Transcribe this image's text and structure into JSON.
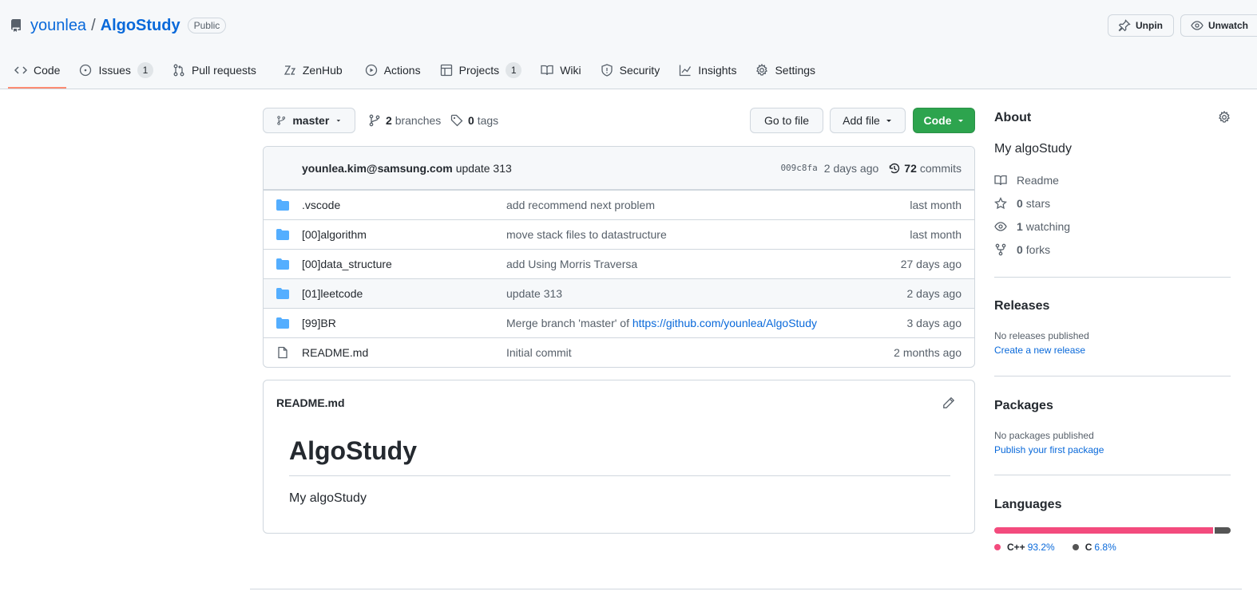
{
  "repo": {
    "owner": "younlea",
    "separator": "/",
    "name": "AlgoStudy",
    "visibility": "Public"
  },
  "header_actions": {
    "unpin": "Unpin",
    "unwatch": "Unwatch"
  },
  "tabs": [
    {
      "label": "Code",
      "icon": "code-icon",
      "counter": ""
    },
    {
      "label": "Issues",
      "icon": "issue-icon",
      "counter": "1"
    },
    {
      "label": "Pull requests",
      "icon": "pull-request-icon",
      "counter": ""
    },
    {
      "label": "ZenHub",
      "icon": "zenhub-icon",
      "counter": ""
    },
    {
      "label": "Actions",
      "icon": "play-icon",
      "counter": ""
    },
    {
      "label": "Projects",
      "icon": "table-icon",
      "counter": "1"
    },
    {
      "label": "Wiki",
      "icon": "book-icon",
      "counter": ""
    },
    {
      "label": "Security",
      "icon": "shield-icon",
      "counter": ""
    },
    {
      "label": "Insights",
      "icon": "graph-icon",
      "counter": ""
    },
    {
      "label": "Settings",
      "icon": "gear-icon",
      "counter": ""
    }
  ],
  "toolbar": {
    "branch": "master",
    "branches_count": "2",
    "branches_label": "branches",
    "tags_count": "0",
    "tags_label": "tags",
    "go_to_file": "Go to file",
    "add_file": "Add file",
    "code": "Code"
  },
  "latest_commit": {
    "author": "younlea.kim@samsung.com",
    "message": "update 313",
    "sha": "009c8fa",
    "time": "2 days ago",
    "commits_count": "72",
    "commits_label": "commits"
  },
  "files": [
    {
      "name": ".vscode",
      "type": "folder",
      "message": "add recommend next problem",
      "link": "",
      "date": "last month"
    },
    {
      "name": "[00]algorithm",
      "type": "folder",
      "message": "move stack files to datastructure",
      "link": "",
      "date": "last month"
    },
    {
      "name": "[00]data_structure",
      "type": "folder",
      "message": "add Using Morris Traversa",
      "link": "",
      "date": "27 days ago"
    },
    {
      "name": "[01]leetcode",
      "type": "folder",
      "message": "update 313",
      "link": "",
      "date": "2 days ago"
    },
    {
      "name": "[99]BR",
      "type": "folder",
      "message": "Merge branch 'master' of ",
      "link": "https://github.com/younlea/AlgoStudy",
      "date": "3 days ago"
    },
    {
      "name": "README.md",
      "type": "file",
      "message": "Initial commit",
      "link": "",
      "date": "2 months ago"
    }
  ],
  "readme": {
    "filename": "README.md",
    "heading": "AlgoStudy",
    "body": "My algoStudy"
  },
  "about": {
    "title": "About",
    "description": "My algoStudy",
    "readme": "Readme",
    "stars_count": "0",
    "stars_label": "stars",
    "watching_count": "1",
    "watching_label": "watching",
    "forks_count": "0",
    "forks_label": "forks"
  },
  "releases": {
    "title": "Releases",
    "empty": "No releases published",
    "link": "Create a new release"
  },
  "packages": {
    "title": "Packages",
    "empty": "No packages published",
    "link": "Publish your first package"
  },
  "languages": {
    "title": "Languages",
    "items": [
      {
        "name": "C++",
        "percent": "93.2%",
        "value": 93.2,
        "color": "#f34b7d"
      },
      {
        "name": "C",
        "percent": "6.8%",
        "value": 6.8,
        "color": "#555555"
      }
    ]
  },
  "colors": {
    "accent": "#0969da",
    "primary_button": "#2da44e",
    "tab_underline": "#fd8c73",
    "folder": "#54aeff"
  }
}
